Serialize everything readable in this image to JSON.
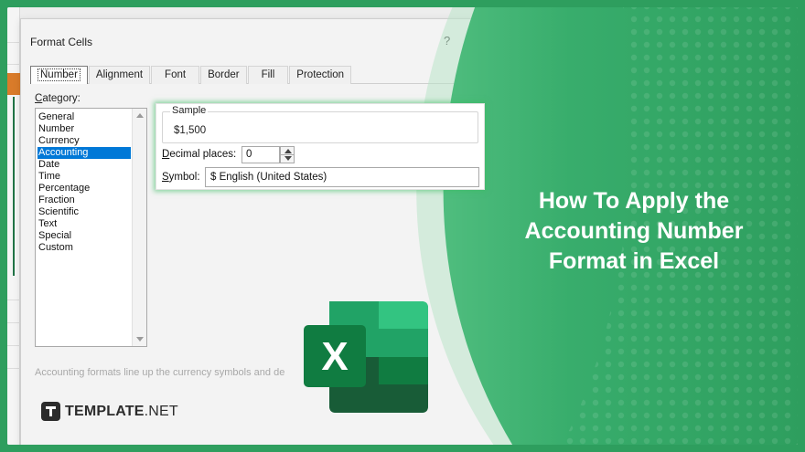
{
  "dialog": {
    "title": "Format Cells",
    "help": "?",
    "close": "✕",
    "tabs": [
      "Number",
      "Alignment",
      "Font",
      "Border",
      "Fill",
      "Protection"
    ],
    "active_tab": "Number",
    "category_label": "Category:",
    "categories": [
      "General",
      "Number",
      "Currency",
      "Accounting",
      "Date",
      "Time",
      "Percentage",
      "Fraction",
      "Scientific",
      "Text",
      "Special",
      "Custom"
    ],
    "selected_category": "Accounting",
    "sample_label": "Sample",
    "sample_value": "$1,500",
    "decimal_places_label": "Decimal places:",
    "decimal_places_value": "0",
    "symbol_label": "Symbol:",
    "symbol_value": "$ English (United States)",
    "description": "Accounting formats line up the currency symbols and de"
  },
  "headline": "How To Apply the Accounting Number Format in Excel",
  "headline_lines": [
    "How To Apply the",
    "Accounting Number",
    "Format in Excel"
  ],
  "excel_logo": {
    "letter": "X",
    "icon": "excel-logo-icon"
  },
  "brand": {
    "bold": "TEMPLATE",
    "rest": ".NET",
    "icon": "template-logo-icon"
  },
  "colors": {
    "frame_green": "#2e9e5e",
    "excel_dark": "#185c37",
    "excel_mid": "#21a366",
    "excel_light": "#33c481",
    "selection_blue": "#0078d7"
  }
}
